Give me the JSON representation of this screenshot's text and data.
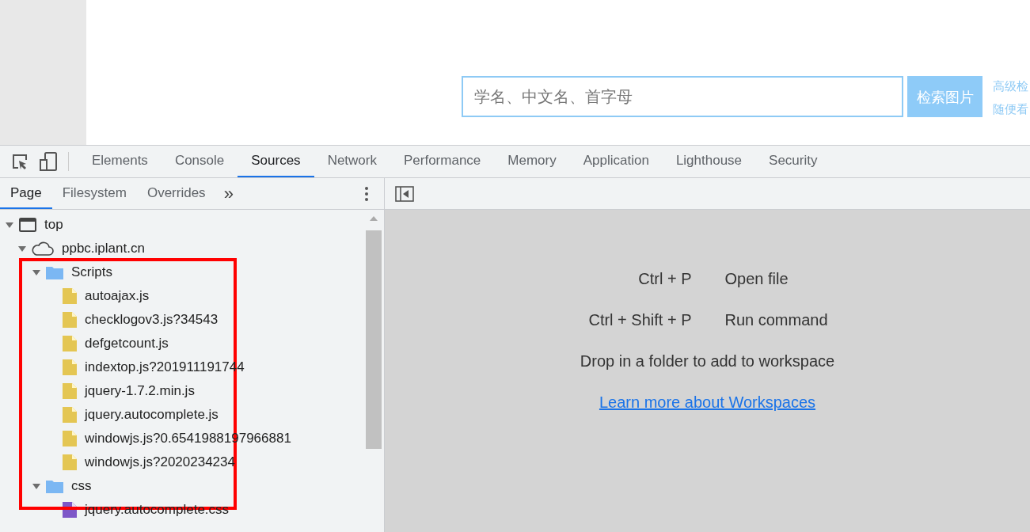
{
  "page": {
    "search": {
      "placeholder": "学名、中文名、首字母"
    },
    "search_button": "检索图片",
    "links": [
      "高级检",
      "随便看"
    ]
  },
  "devtools": {
    "tabs": [
      {
        "label": "Elements",
        "selected": false
      },
      {
        "label": "Console",
        "selected": false
      },
      {
        "label": "Sources",
        "selected": true
      },
      {
        "label": "Network",
        "selected": false
      },
      {
        "label": "Performance",
        "selected": false
      },
      {
        "label": "Memory",
        "selected": false
      },
      {
        "label": "Application",
        "selected": false
      },
      {
        "label": "Lighthouse",
        "selected": false
      },
      {
        "label": "Security",
        "selected": false
      }
    ],
    "sub_tabs": [
      {
        "label": "Page",
        "selected": true
      },
      {
        "label": "Filesystem",
        "selected": false
      },
      {
        "label": "Overrides",
        "selected": false
      }
    ],
    "more_tabs": "»",
    "tree": [
      {
        "kind": "frame",
        "label": "top",
        "expanded": true,
        "children": [
          {
            "kind": "domain",
            "label": "ppbc.iplant.cn",
            "expanded": true,
            "children": [
              {
                "kind": "folder",
                "label": "Scripts",
                "expanded": true,
                "children": [
                  {
                    "kind": "script",
                    "label": "autoajax.js"
                  },
                  {
                    "kind": "script",
                    "label": "checklogov3.js?34543"
                  },
                  {
                    "kind": "script",
                    "label": "defgetcount.js"
                  },
                  {
                    "kind": "script",
                    "label": "indextop.js?201911191744"
                  },
                  {
                    "kind": "script",
                    "label": "jquery-1.7.2.min.js"
                  },
                  {
                    "kind": "script",
                    "label": "jquery.autocomplete.js"
                  },
                  {
                    "kind": "script",
                    "label": "windowjs.js?0.6541988197966881"
                  },
                  {
                    "kind": "script",
                    "label": "windowjs.js?2020234234"
                  }
                ]
              },
              {
                "kind": "folder",
                "label": "css",
                "expanded": true,
                "children": [
                  {
                    "kind": "stylesheet",
                    "label": "jquery.autocomplete.css"
                  }
                ]
              }
            ]
          }
        ]
      }
    ],
    "shortcuts": [
      {
        "keys": "Ctrl + P",
        "action": "Open file"
      },
      {
        "keys": "Ctrl + Shift + P",
        "action": "Run command"
      }
    ],
    "hint": "Drop in a folder to add to workspace",
    "link": "Learn more about Workspaces"
  }
}
